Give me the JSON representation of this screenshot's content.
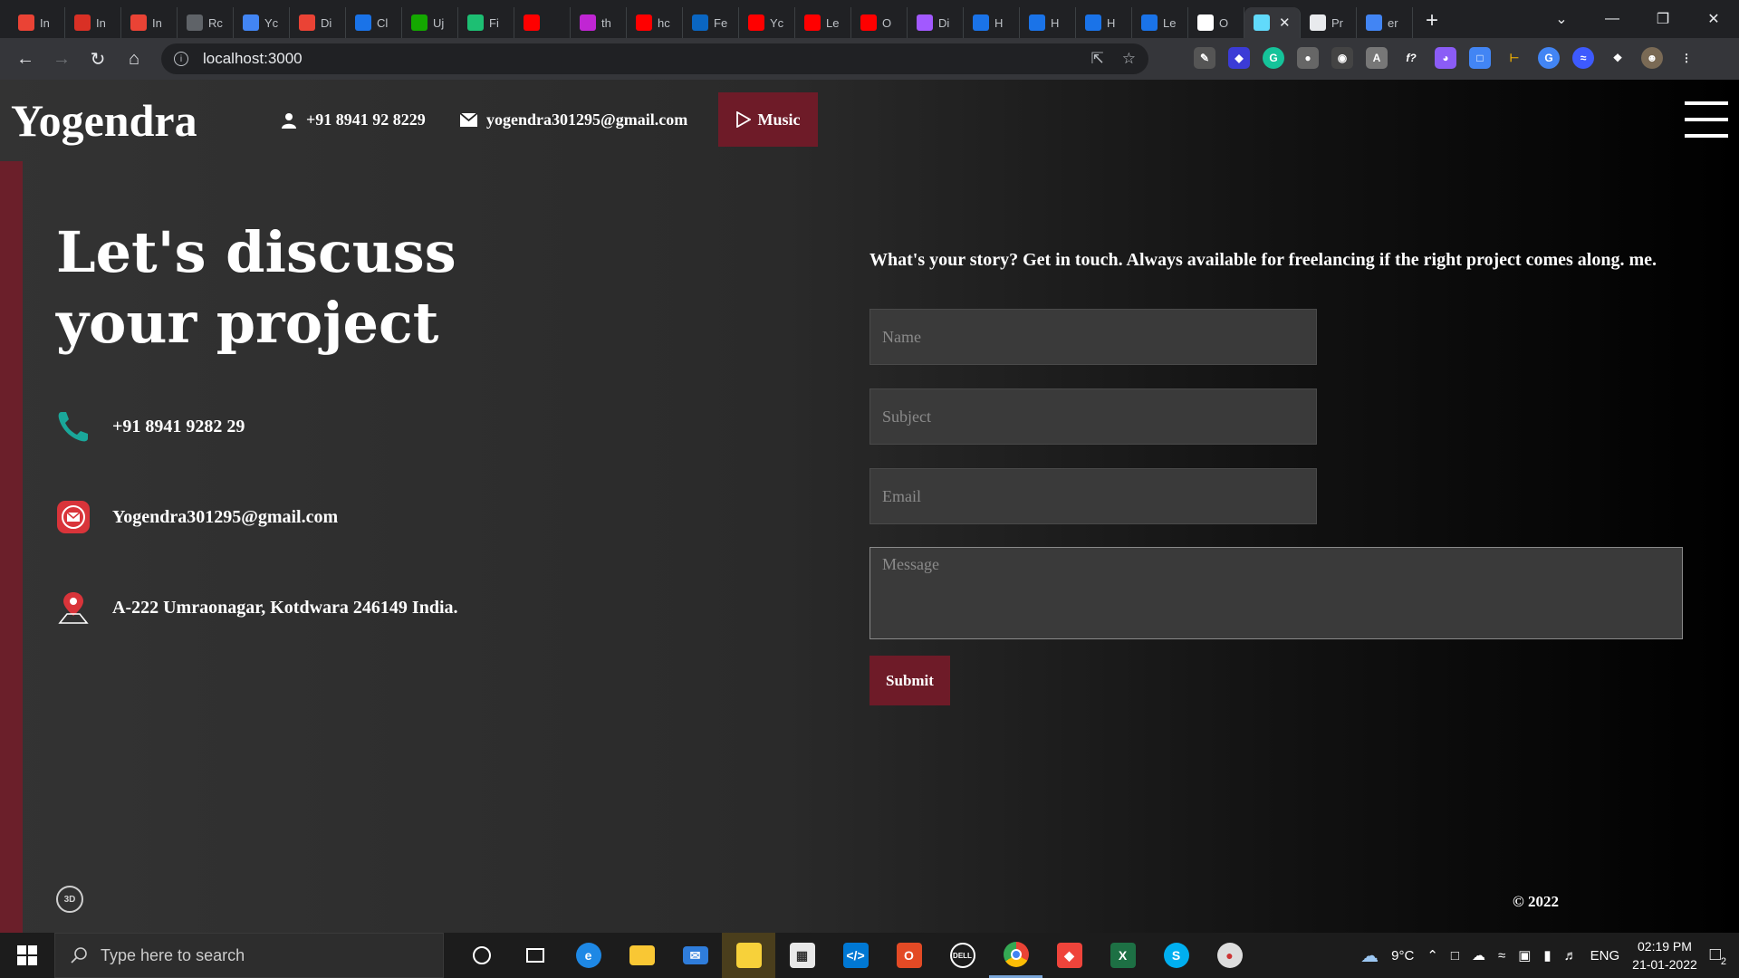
{
  "browser": {
    "tabs": [
      {
        "label": "In",
        "icon": "gmail-icon",
        "color": "#ea4335"
      },
      {
        "label": "In",
        "icon": "inbox-icon",
        "color": "#d93025"
      },
      {
        "label": "In",
        "icon": "gmail-icon",
        "color": "#ea4335"
      },
      {
        "label": "Rc",
        "icon": "globe-icon",
        "color": "#5f6368"
      },
      {
        "label": "Yc",
        "icon": "search-icon",
        "color": "#4285f4"
      },
      {
        "label": "Di",
        "icon": "d-icon",
        "color": "#ea4335"
      },
      {
        "label": "Cl",
        "icon": "cube-icon",
        "color": "#1a73e8"
      },
      {
        "label": "Uj",
        "icon": "upwork-icon",
        "color": "#14a800"
      },
      {
        "label": "Fi",
        "icon": "fiverr-icon",
        "color": "#1dbf73"
      },
      {
        "label": "",
        "icon": "youtube-icon",
        "color": "#ff0000"
      },
      {
        "label": "th",
        "icon": "w-icon",
        "color": "#c026d3"
      },
      {
        "label": "hc",
        "icon": "youtube-icon",
        "color": "#ff0000"
      },
      {
        "label": "Fe",
        "icon": "linkedin-icon",
        "color": "#0a66c2"
      },
      {
        "label": "Yc",
        "icon": "youtube-icon",
        "color": "#ff0000"
      },
      {
        "label": "Le",
        "icon": "youtube-icon",
        "color": "#ff0000"
      },
      {
        "label": "O",
        "icon": "youtube-icon",
        "color": "#ff0000"
      },
      {
        "label": "Di",
        "icon": "figma-icon",
        "color": "#a259ff"
      },
      {
        "label": "H",
        "icon": "c-icon",
        "color": "#1a73e8"
      },
      {
        "label": "H",
        "icon": "c-icon",
        "color": "#1a73e8"
      },
      {
        "label": "H",
        "icon": "c-icon",
        "color": "#1a73e8"
      },
      {
        "label": "Le",
        "icon": "c-icon",
        "color": "#1a73e8"
      },
      {
        "label": "O",
        "icon": "amazon-icon",
        "color": "#ffffff"
      },
      {
        "label": "",
        "icon": "react-icon",
        "color": "#61dafb",
        "active": true
      },
      {
        "label": "Pr",
        "icon": "compass-icon",
        "color": "#e8eaed"
      },
      {
        "label": "er",
        "icon": "google-icon",
        "color": "#4285f4"
      }
    ],
    "url": "localhost:3000"
  },
  "header": {
    "brand": "Yogendra",
    "phone": "+91 8941 92 8229",
    "email": "yogendra301295@gmail.com",
    "music_label": "Music"
  },
  "main": {
    "heading": "Let's discuss your project",
    "contacts": [
      {
        "icon": "phone-icon",
        "text": "+91 8941 9282 29"
      },
      {
        "icon": "mail-icon",
        "text": "Yogendra301295@gmail.com"
      },
      {
        "icon": "location-pin-icon",
        "text": "A-222 Umraonagar, Kotdwara 246149 India."
      }
    ],
    "story": "What's your story?  Get in touch. Always available for freelancing if the right project comes along. me.",
    "form": {
      "name_placeholder": "Name",
      "subject_placeholder": "Subject",
      "email_placeholder": "Email",
      "message_placeholder": "Message",
      "submit_label": "Submit"
    },
    "badge_3d": "3D",
    "copyright": "© 2022"
  },
  "taskbar": {
    "search_placeholder": "Type here to search",
    "weather": "9°C",
    "language": "ENG",
    "time": "02:19 PM",
    "date": "21-01-2022",
    "notifications": "2"
  },
  "colors": {
    "accent": "#6e1b28",
    "phone_icon": "#1aa79a",
    "mail_icon": "#d9343a"
  }
}
